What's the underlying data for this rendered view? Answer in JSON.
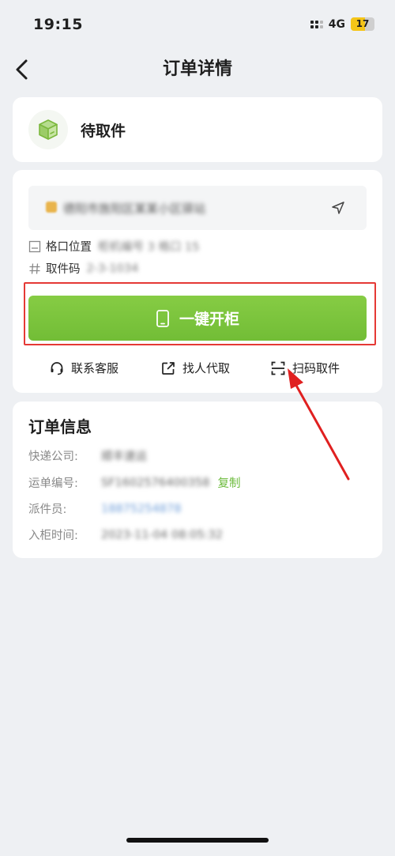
{
  "status_bar": {
    "time": "19:15",
    "network": "4G",
    "battery": "17"
  },
  "nav": {
    "title": "订单详情",
    "back_icon": "chevron-left-icon"
  },
  "package_status": {
    "icon": "package-box-icon",
    "label": "待取件"
  },
  "pickup": {
    "address": "德阳市旌阳区某某小区驿站",
    "cell_label": "格口位置",
    "cell_value": "柜机编号 3 格口 15",
    "code_label": "取件码",
    "code_value": "2-3-1034",
    "open_button_label": "一键开柜",
    "actions": [
      {
        "icon": "headset-icon",
        "label": "联系客服"
      },
      {
        "icon": "share-external-icon",
        "label": "找人代取"
      },
      {
        "icon": "scan-icon",
        "label": "扫码取件"
      }
    ]
  },
  "order_info": {
    "title": "订单信息",
    "rows": [
      {
        "label": "快递公司:",
        "value": "顺丰速运"
      },
      {
        "label": "运单编号:",
        "value": "SF1602576400358"
      },
      {
        "label": "派件员:",
        "value": "18875254878"
      },
      {
        "label": "入柜时间:",
        "value": "2023-11-04 08:05:32"
      }
    ],
    "copy_label": "复制"
  },
  "colors": {
    "accent_green": "#7cc43c",
    "highlight_red": "#e53935",
    "background": "#eef0f3"
  }
}
